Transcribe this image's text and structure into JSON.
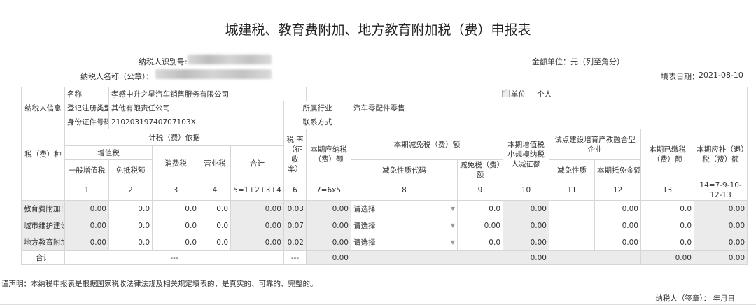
{
  "title": "城建税、教育费附加、地方教育附加税（费）申报表",
  "header": {
    "taxpayer_id_label": "纳税人识别号:",
    "taxpayer_name_label": "纳税人名称（公章）：",
    "amount_unit": "金额单位：元（列至角分）",
    "fill_date_label": "填表日期：",
    "fill_date": "2021-08-10"
  },
  "info": {
    "section_label": "纳税人信息",
    "name_label": "名称",
    "name_value": "孝感中升之星汽车销售服务有限公司",
    "unit_label": "单位",
    "person_label": "个人",
    "reg_type_label": "登记注册类型",
    "reg_type_value": "其他有限责任公司",
    "industry_label": "所属行业",
    "industry_value": "汽车零配件零售",
    "id_label": "身份证件号码",
    "id_value": "21020319740707103X",
    "contact_label": "联系方式",
    "contact_value": ""
  },
  "headers": {
    "tax_type": "税（费）种",
    "basis": "计税（费）依据",
    "vat": "增值税",
    "general_vat": "一般增值税",
    "exempt_offset": "免抵税额",
    "consumption": "消费税",
    "business": "营业税",
    "total": "合计",
    "rate": "税 率（征收率）",
    "payable": "本期应纳税（费）额",
    "reduction": "本期减免税（费）额",
    "reduction_code": "减免性质代码",
    "reduction_amount": "减免税（费）额",
    "small_scale": "本期增值税小规模纳税人减征额",
    "pilot": "试点建设培育产教融合型企业",
    "pilot_nature": "减免性质",
    "pilot_offset": "本期抵免金额",
    "paid": "本期已缴税（费）额",
    "refund": "本期应补（退）税（费）额"
  },
  "col_numbers": [
    "1",
    "2",
    "3",
    "4",
    "5=1+2+3+4",
    "6",
    "7=6x5",
    "8",
    "9",
    "10",
    "11",
    "12",
    "13",
    "14=7-9-10-12-13"
  ],
  "rows": [
    {
      "name": "教育费附加!",
      "c1": "0.00",
      "c2": "0.0",
      "c3": "0.0",
      "c4": "0.0",
      "c5": "0.00",
      "c6": "0.03",
      "c7": "0.00",
      "c8": "请选择",
      "c9": "0.0",
      "c10": "0.00",
      "c11": "",
      "c12": "0.00",
      "c13": "0.0",
      "c14": "0.00"
    },
    {
      "name": "城市维护建设",
      "c1": "0.00",
      "c2": "0.0",
      "c3": "0.0",
      "c4": "0.0",
      "c5": "0.00",
      "c6": "0.07",
      "c7": "0.00",
      "c8": "请选择",
      "c9": "0.00",
      "c10": "0.00",
      "c11": "",
      "c12": "0.00",
      "c13": "0.0",
      "c14": "0.00"
    },
    {
      "name": "地方教育附加",
      "c1": "0.00",
      "c2": "0.0",
      "c3": "0.0",
      "c4": "0.0",
      "c5": "0.00",
      "c6": "0.02",
      "c7": "0.00",
      "c8": "请选择",
      "c9": "0.0",
      "c10": "0.00",
      "c11": "",
      "c12": "0.00",
      "c13": "0.0",
      "c14": "0.00"
    }
  ],
  "total_row": {
    "label": "合计",
    "basis": "---",
    "rate": "---",
    "c7": "0.00",
    "c10": "0.00",
    "c13": "0.00",
    "c14": "0.00"
  },
  "footer": {
    "declaration": "谨声明：本纳税申报表是根据国家税收法律法规及相关规定填表的，是真实的、可靠的、完整的。",
    "signature": "纳税人（签章）：  年月日"
  }
}
